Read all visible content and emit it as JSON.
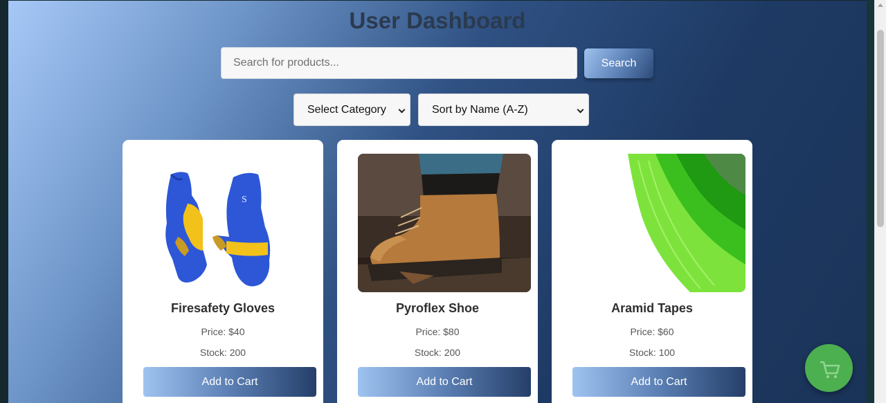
{
  "header": {
    "title": "User Dashboard"
  },
  "search": {
    "placeholder": "Search for products...",
    "value": "",
    "button_label": "Search"
  },
  "filters": {
    "category_selected": "Select Category",
    "sort_selected": "Sort by Name (A-Z)"
  },
  "products": [
    {
      "name": "Firesafety Gloves",
      "price": "Price: $40",
      "stock": "Stock: 200",
      "button_label": "Add to Cart",
      "image": "blue-welding-gloves"
    },
    {
      "name": "Pyroflex Shoe",
      "price": "Price: $80",
      "stock": "Stock: 200",
      "button_label": "Add to Cart",
      "image": "leather-work-boot"
    },
    {
      "name": "Aramid Tapes",
      "price": "Price: $60",
      "stock": "Stock: 100",
      "button_label": "Add to Cart",
      "image": "green-tape-roll"
    }
  ],
  "floating_button": {
    "icon": "cart-icon",
    "color": "#4caf50"
  },
  "colors": {
    "accent": "#1e3a64",
    "card_bg": "#ffffff",
    "cart_fab": "#4caf50"
  }
}
